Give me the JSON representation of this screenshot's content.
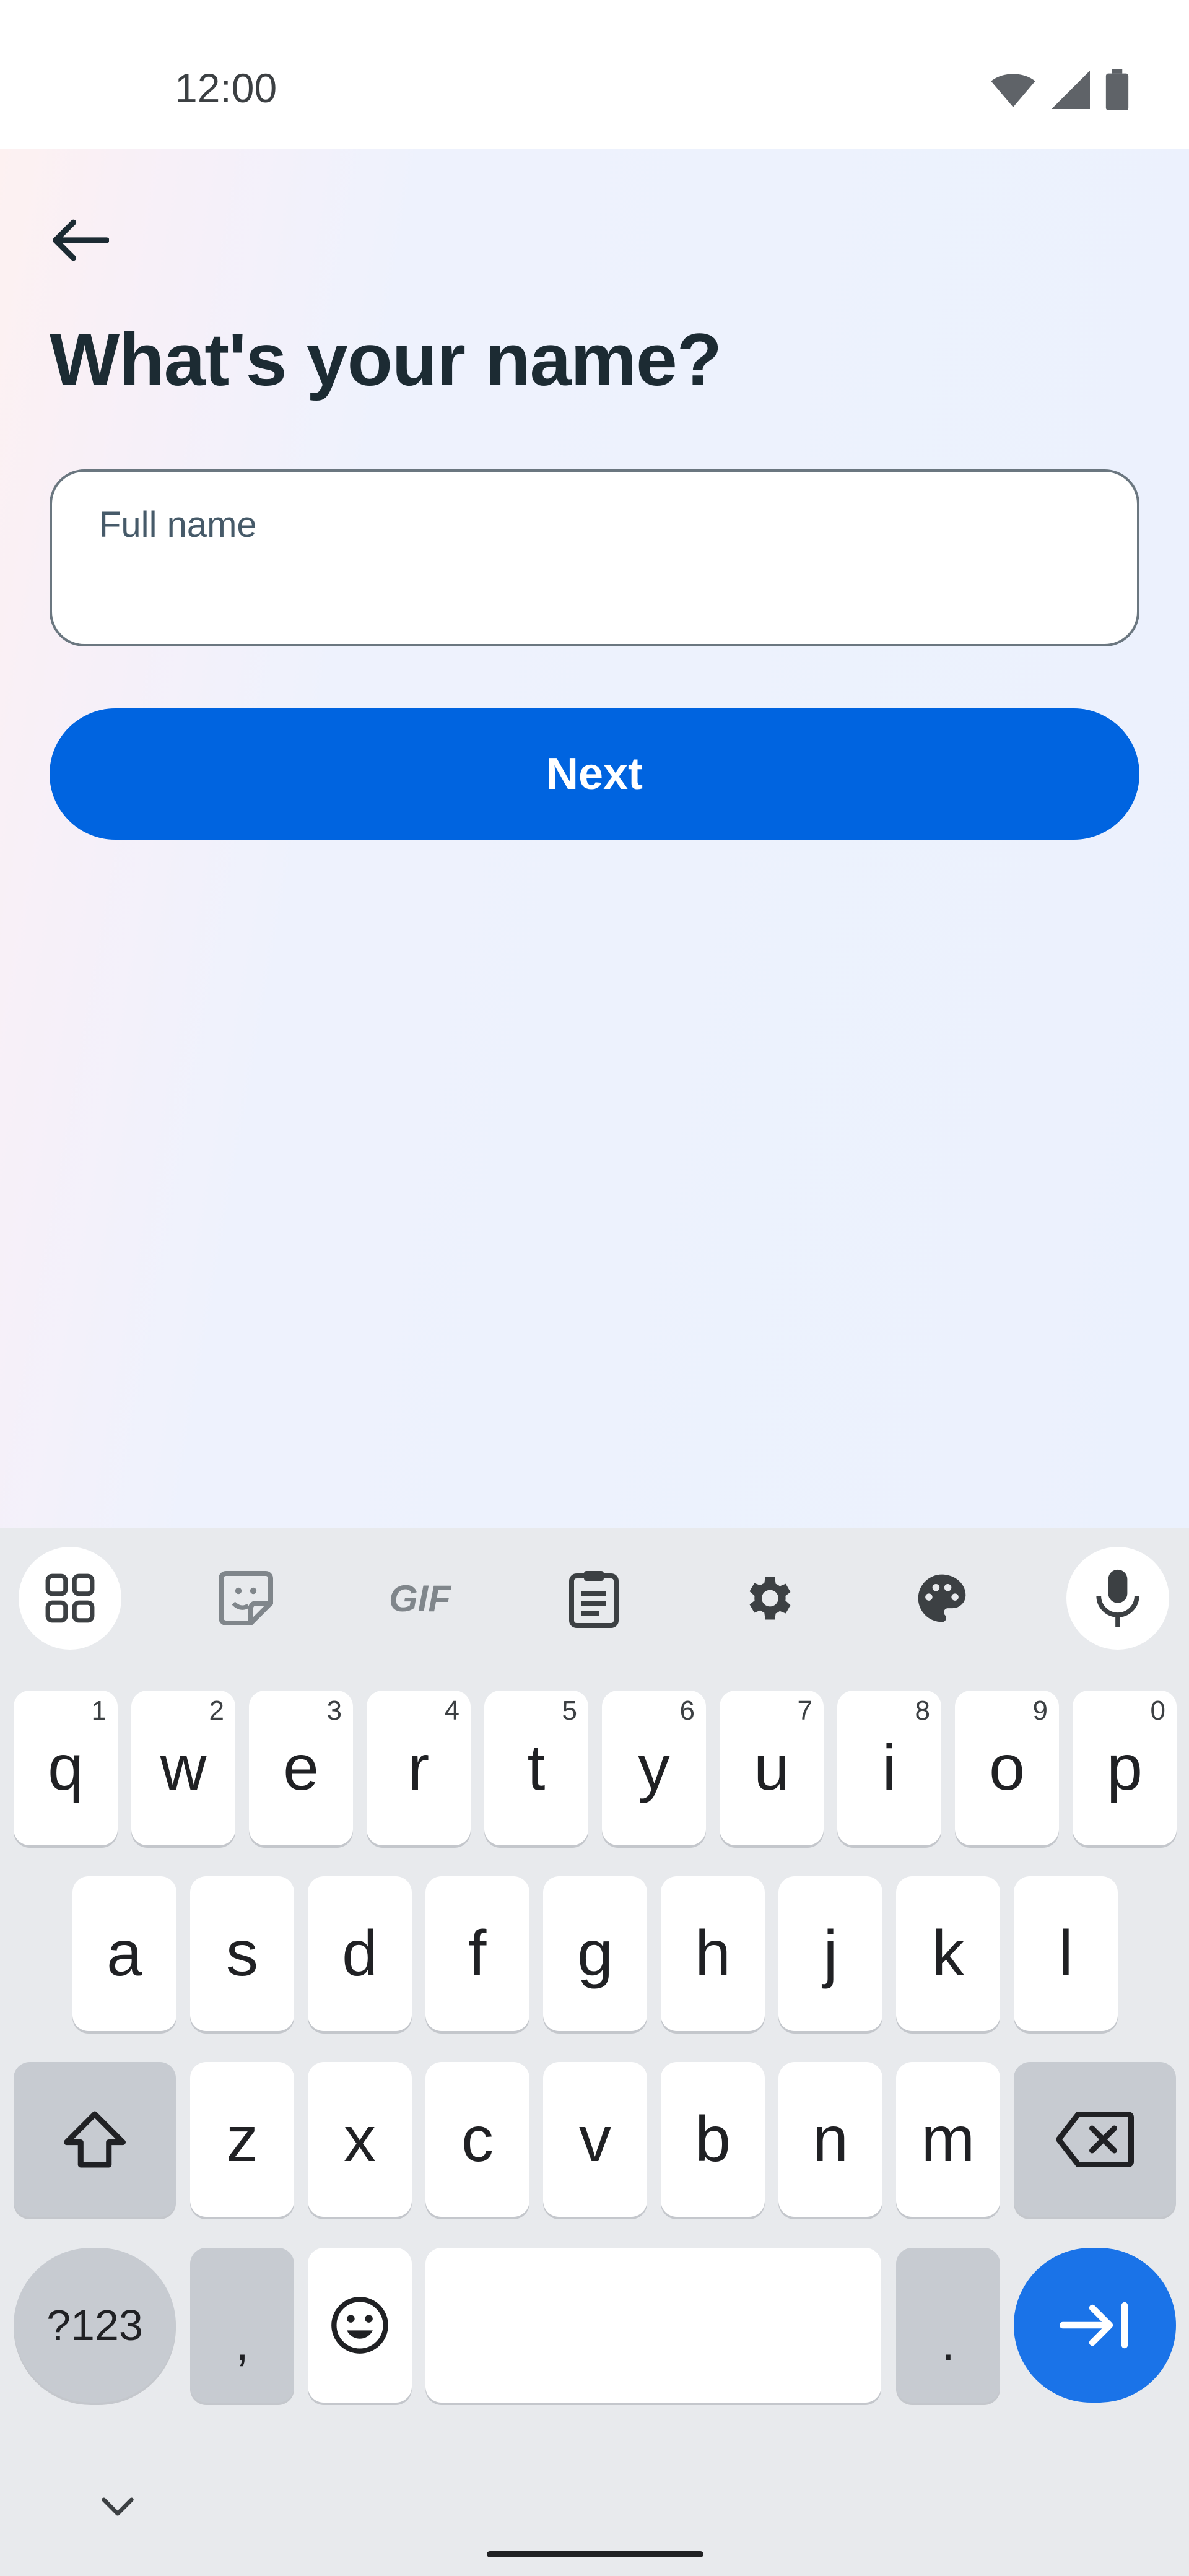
{
  "status_bar": {
    "time": "12:00"
  },
  "header": {
    "title": "What's your name?"
  },
  "form": {
    "name_label": "Full name",
    "name_value": "",
    "next_label": "Next"
  },
  "keyboard": {
    "toolbar": [
      "apps-icon",
      "sticker-icon",
      "GIF",
      "clipboard-icon",
      "settings-icon",
      "palette-icon",
      "mic-icon"
    ],
    "gif_label": "GIF",
    "row1": [
      {
        "key": "q",
        "hint": "1"
      },
      {
        "key": "w",
        "hint": "2"
      },
      {
        "key": "e",
        "hint": "3"
      },
      {
        "key": "r",
        "hint": "4"
      },
      {
        "key": "t",
        "hint": "5"
      },
      {
        "key": "y",
        "hint": "6"
      },
      {
        "key": "u",
        "hint": "7"
      },
      {
        "key": "i",
        "hint": "8"
      },
      {
        "key": "o",
        "hint": "9"
      },
      {
        "key": "p",
        "hint": "0"
      }
    ],
    "row2": [
      "a",
      "s",
      "d",
      "f",
      "g",
      "h",
      "j",
      "k",
      "l"
    ],
    "row3": [
      "z",
      "x",
      "c",
      "v",
      "b",
      "n",
      "m"
    ],
    "symbols_label": "?123",
    "comma_label": ",",
    "period_label": "."
  },
  "colors": {
    "accent": "#0064e0",
    "keyboard_accent": "#1a73e8",
    "title": "#1c2b33"
  }
}
